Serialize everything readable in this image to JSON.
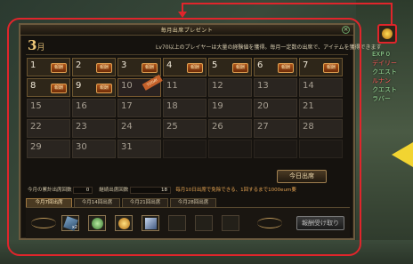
{
  "window": {
    "title": "毎月出席プレゼント",
    "close_label": "×",
    "month_number": "3",
    "month_suffix": "月",
    "description": "Lv70以上のプレイヤーは大量の経験値を獲得。毎月一定数の出席で、アイテムを獲得できます"
  },
  "calendar": {
    "stamp_label": "報酬",
    "today_ribbon": "TODAY",
    "days": [
      {
        "n": "1",
        "state": "claimed"
      },
      {
        "n": "2",
        "state": "claimed"
      },
      {
        "n": "3",
        "state": "claimed"
      },
      {
        "n": "4",
        "state": "claimed"
      },
      {
        "n": "5",
        "state": "claimed"
      },
      {
        "n": "6",
        "state": "claimed"
      },
      {
        "n": "7",
        "state": "claimed"
      },
      {
        "n": "8",
        "state": "claimed"
      },
      {
        "n": "9",
        "state": "claimed"
      },
      {
        "n": "10",
        "state": "today"
      },
      {
        "n": "11",
        "state": "open"
      },
      {
        "n": "12",
        "state": "open"
      },
      {
        "n": "13",
        "state": "open"
      },
      {
        "n": "14",
        "state": "open"
      },
      {
        "n": "15",
        "state": "open"
      },
      {
        "n": "16",
        "state": "open"
      },
      {
        "n": "17",
        "state": "open"
      },
      {
        "n": "18",
        "state": "open"
      },
      {
        "n": "19",
        "state": "open"
      },
      {
        "n": "20",
        "state": "open"
      },
      {
        "n": "21",
        "state": "open"
      },
      {
        "n": "22",
        "state": "open"
      },
      {
        "n": "23",
        "state": "open"
      },
      {
        "n": "24",
        "state": "open"
      },
      {
        "n": "25",
        "state": "open"
      },
      {
        "n": "26",
        "state": "open"
      },
      {
        "n": "27",
        "state": "open"
      },
      {
        "n": "28",
        "state": "open"
      },
      {
        "n": "29",
        "state": "open"
      },
      {
        "n": "30",
        "state": "open"
      },
      {
        "n": "31",
        "state": "open"
      },
      {
        "n": "",
        "state": "empty"
      },
      {
        "n": "",
        "state": "empty"
      },
      {
        "n": "",
        "state": "empty"
      },
      {
        "n": "",
        "state": "empty"
      }
    ]
  },
  "today_button": "今日出席",
  "stats": {
    "monthly_label": "今月の累計出席回数",
    "monthly_value": "0",
    "total_label": "継続出席回数",
    "total_value": "18",
    "note": "毎月10日出席で免除できる、1回するまで1000eum要"
  },
  "tabs": [
    "今月7回出席",
    "今月14回出席",
    "今月21回出席",
    "今月28回出席"
  ],
  "rewards": {
    "slot1_count": "x2",
    "receive_button": "報酬受け取り"
  },
  "side_list": [
    "EXP 0",
    "デイリー",
    "クエスト",
    "ルナン",
    "クエスト",
    "ラバー"
  ]
}
